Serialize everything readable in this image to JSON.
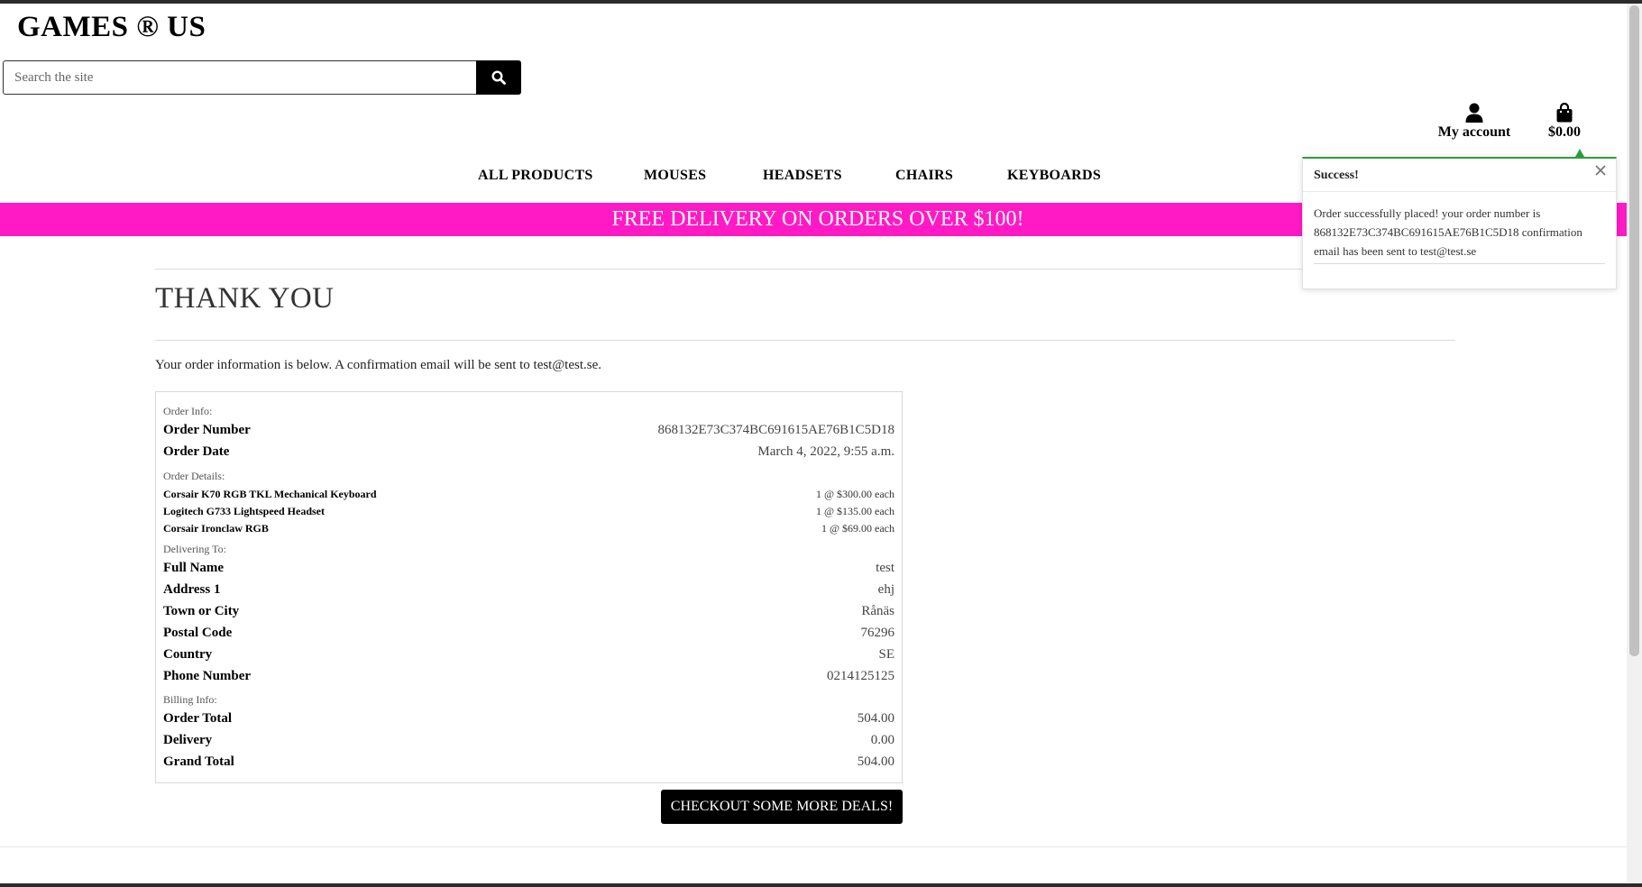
{
  "brand": {
    "name": "GAMES ® US"
  },
  "search": {
    "placeholder": "Search the site",
    "icon": "search-icon"
  },
  "header": {
    "account_label": "My account",
    "account_icon": "user-icon",
    "bag_total": "$0.00",
    "bag_icon": "shopping-bag-icon"
  },
  "nav": {
    "items": [
      {
        "label": "ALL PRODUCTS"
      },
      {
        "label": "MOUSES"
      },
      {
        "label": "HEADSETS"
      },
      {
        "label": "CHAIRS"
      },
      {
        "label": "KEYBOARDS"
      }
    ]
  },
  "banner": {
    "text": "FREE DELIVERY ON ORDERS OVER $100!",
    "color": "#ff1ac6"
  },
  "page": {
    "title": "THANK YOU",
    "intro": "Your order information is below. A confirmation email will be sent to test@test.se."
  },
  "order": {
    "info_label": "Order Info:",
    "number_label": "Order Number",
    "number": "868132E73C374BC691615AE76B1C5D18",
    "date_label": "Order Date",
    "date": "March 4, 2022, 9:55 a.m.",
    "details_label": "Order Details:",
    "items": [
      {
        "name": "Corsair K70 RGB TKL Mechanical Keyboard",
        "qty_price": "1 @ $300.00 each"
      },
      {
        "name": "Logitech G733 Lightspeed Headset",
        "qty_price": "1 @ $135.00 each"
      },
      {
        "name": "Corsair Ironclaw RGB",
        "qty_price": "1 @ $69.00 each"
      }
    ],
    "delivery_label": "Delivering To:",
    "delivery": [
      {
        "label": "Full Name",
        "value": "test"
      },
      {
        "label": "Address 1",
        "value": "ehj"
      },
      {
        "label": "Town or City",
        "value": "Rånäs"
      },
      {
        "label": "Postal Code",
        "value": "76296"
      },
      {
        "label": "Country",
        "value": "SE"
      },
      {
        "label": "Phone Number",
        "value": "0214125125"
      }
    ],
    "billing_label": "Billing Info:",
    "billing": [
      {
        "label": "Order Total",
        "value": "504.00"
      },
      {
        "label": "Delivery",
        "value": "0.00"
      },
      {
        "label": "Grand Total",
        "value": "504.00"
      }
    ]
  },
  "cta": {
    "label": "CHECKOUT SOME MORE DEALS!"
  },
  "toast": {
    "title": "Success!",
    "message": "Order successfully placed! your order number is 868132E73C374BC691615AE76B1C5D18 confirmation email has been sent to test@test.se",
    "accent": "#2e9e3e",
    "close_icon": "close-icon"
  }
}
